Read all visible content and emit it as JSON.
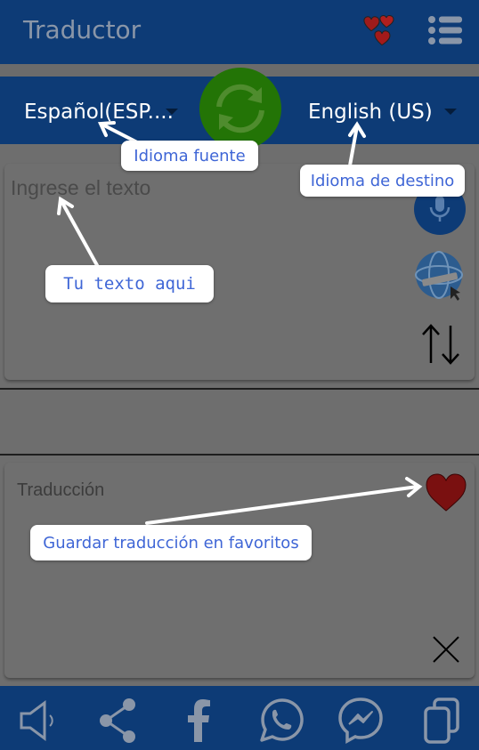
{
  "app": {
    "title": "Traductor"
  },
  "languages": {
    "source": "Español(ESP....",
    "target": "English (US)"
  },
  "input": {
    "placeholder": "Ingrese el texto"
  },
  "output": {
    "label": "Traducción"
  },
  "callouts": {
    "source_language": "Idioma fuente",
    "target_language": "Idioma de destino",
    "your_text": "Tu texto aqui",
    "save_favorite": "Guardar traducción en favoritos"
  },
  "icons": {
    "header": [
      "hearts-icon",
      "menu-list-icon"
    ],
    "swap": "refresh-icon",
    "input_tools": [
      "microphone-icon",
      "globe-web-icon",
      "swap-arrows-icon"
    ],
    "output_tools": [
      "heart-icon",
      "close-icon"
    ],
    "bottom": [
      "speaker-icon",
      "share-icon",
      "facebook-icon",
      "whatsapp-icon",
      "messenger-icon",
      "copy-icon"
    ]
  },
  "colors": {
    "primary": "#0d3b76",
    "swap_button": "#237406",
    "callout_text": "#3f66d6",
    "heart": "#7a1010"
  }
}
